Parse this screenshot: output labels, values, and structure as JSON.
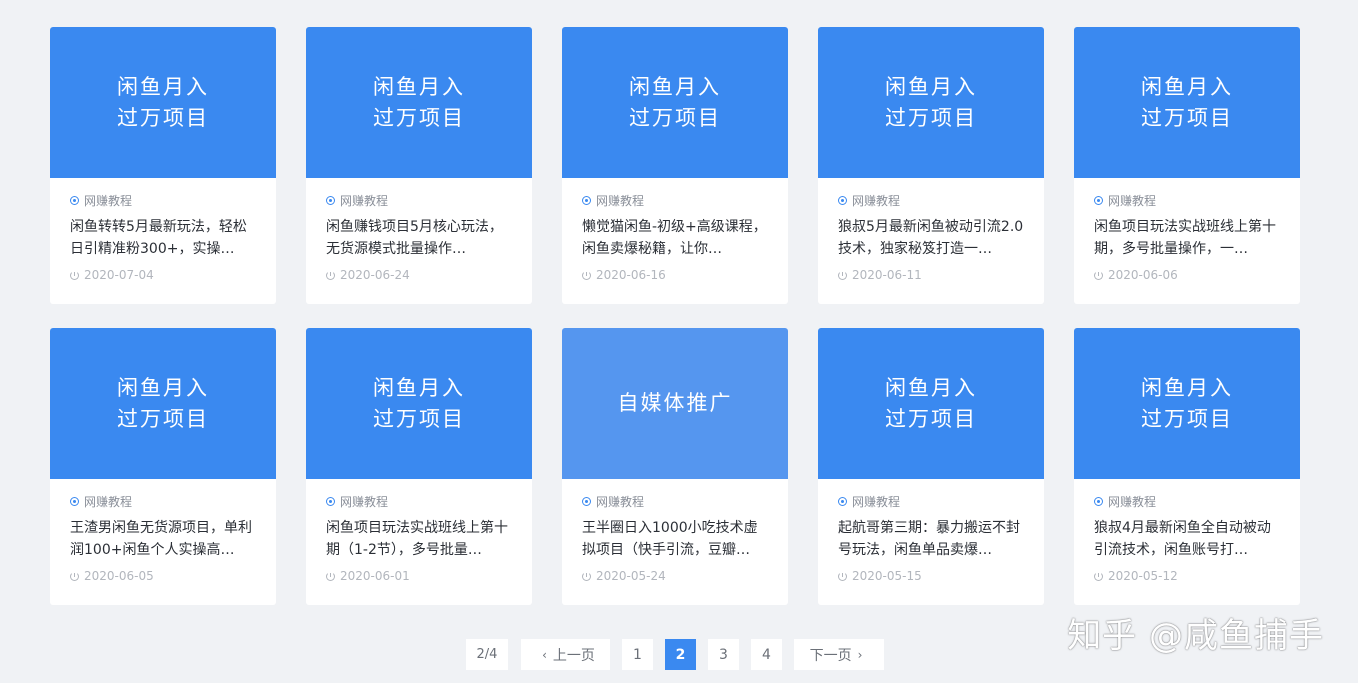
{
  "category_icon_color": "#3a89f0",
  "thumb_color": "#3a89f0",
  "cards": [
    {
      "thumb": [
        "闲鱼月入",
        "过万项目"
      ],
      "category": "网赚教程",
      "title": "闲鱼转转5月最新玩法，轻松日引精准粉300+，实操…",
      "date": "2020-07-04"
    },
    {
      "thumb": [
        "闲鱼月入",
        "过万项目"
      ],
      "category": "网赚教程",
      "title": "闲鱼赚钱项目5月核心玩法，无货源模式批量操作…",
      "date": "2020-06-24"
    },
    {
      "thumb": [
        "闲鱼月入",
        "过万项目"
      ],
      "category": "网赚教程",
      "title": "懒觉猫闲鱼-初级+高级课程，闲鱼卖爆秘籍，让你…",
      "date": "2020-06-16"
    },
    {
      "thumb": [
        "闲鱼月入",
        "过万项目"
      ],
      "category": "网赚教程",
      "title": "狼叔5月最新闲鱼被动引流2.0技术，独家秘笈打造一…",
      "date": "2020-06-11"
    },
    {
      "thumb": [
        "闲鱼月入",
        "过万项目"
      ],
      "category": "网赚教程",
      "title": "闲鱼项目玩法实战班线上第十期，多号批量操作，一…",
      "date": "2020-06-06"
    },
    {
      "thumb": [
        "闲鱼月入",
        "过万项目"
      ],
      "category": "网赚教程",
      "title": "王渣男闲鱼无货源项目，单利润100+闲鱼个人实操高…",
      "date": "2020-06-05"
    },
    {
      "thumb": [
        "闲鱼月入",
        "过万项目"
      ],
      "category": "网赚教程",
      "title": "闲鱼项目玩法实战班线上第十期（1-2节），多号批量…",
      "date": "2020-06-01"
    },
    {
      "thumb": [
        "自媒体推广"
      ],
      "category": "网赚教程",
      "title": "王半圈日入1000小吃技术虚拟项目（快手引流，豆瓣…",
      "date": "2020-05-24"
    },
    {
      "thumb": [
        "闲鱼月入",
        "过万项目"
      ],
      "category": "网赚教程",
      "title": "起航哥第三期：暴力搬运不封号玩法，闲鱼单品卖爆…",
      "date": "2020-05-15"
    },
    {
      "thumb": [
        "闲鱼月入",
        "过万项目"
      ],
      "category": "网赚教程",
      "title": "狼叔4月最新闲鱼全自动被动引流技术，闲鱼账号打…",
      "date": "2020-05-12"
    }
  ],
  "pagination": {
    "info": "2/4",
    "prev": "上一页",
    "pages": [
      "1",
      "2",
      "3",
      "4"
    ],
    "current": "2",
    "next": "下一页"
  },
  "watermark": "知乎 @咸鱼捕手"
}
